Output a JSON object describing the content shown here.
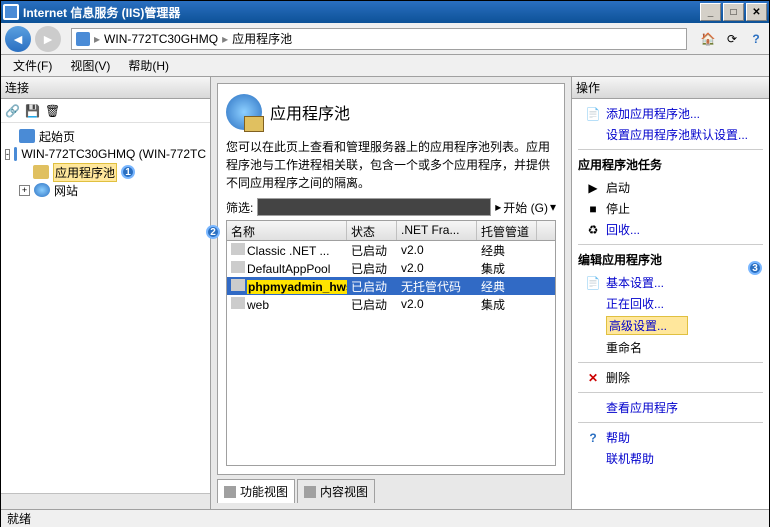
{
  "window": {
    "title": "Internet 信息服务 (IIS)管理器"
  },
  "breadcrumb": {
    "server": "WIN-772TC30GHMQ",
    "page": "应用程序池"
  },
  "menu": {
    "file": "文件(F)",
    "view": "视图(V)",
    "help": "帮助(H)"
  },
  "left": {
    "header": "连接",
    "root": "起始页",
    "server": "WIN-772TC30GHMQ (WIN-772TC",
    "apppools": "应用程序池",
    "sites": "网站"
  },
  "center": {
    "title": "应用程序池",
    "description": "您可以在此页上查看和管理服务器上的应用程序池列表。应用程序池与工作进程相关联，包含一个或多个应用程序，并提供不同应用程序之间的隔离。",
    "filter_label": "筛选:",
    "go_label": "开始 (G)",
    "columns": {
      "name": "名称",
      "status": "状态",
      "net": ".NET Fra...",
      "pipe": "托管管道模"
    },
    "rows": [
      {
        "name": "Classic .NET ...",
        "status": "已启动",
        "net": "v2.0",
        "pipe": "经典"
      },
      {
        "name": "DefaultAppPool",
        "status": "已启动",
        "net": "v2.0",
        "pipe": "集成"
      },
      {
        "name": "phpmyadmin_hws",
        "status": "已启动",
        "net": "无托管代码",
        "pipe": "经典"
      },
      {
        "name": "web",
        "status": "已启动",
        "net": "v2.0",
        "pipe": "集成"
      }
    ],
    "tabs": {
      "features": "功能视图",
      "content": "内容视图"
    }
  },
  "right": {
    "header": "操作",
    "add": "添加应用程序池...",
    "defaults": "设置应用程序池默认设置...",
    "group_tasks": "应用程序池任务",
    "start": "启动",
    "stop": "停止",
    "recycle": "回收...",
    "group_edit": "编辑应用程序池",
    "basic": "基本设置...",
    "recycling": "正在回收...",
    "advanced": "高级设置...",
    "rename": "重命名",
    "delete": "删除",
    "viewapps": "查看应用程序",
    "help": "帮助",
    "online_help": "联机帮助"
  },
  "status": {
    "ready": "就绪"
  },
  "badges": {
    "b1": "1",
    "b2": "2",
    "b3": "3"
  }
}
